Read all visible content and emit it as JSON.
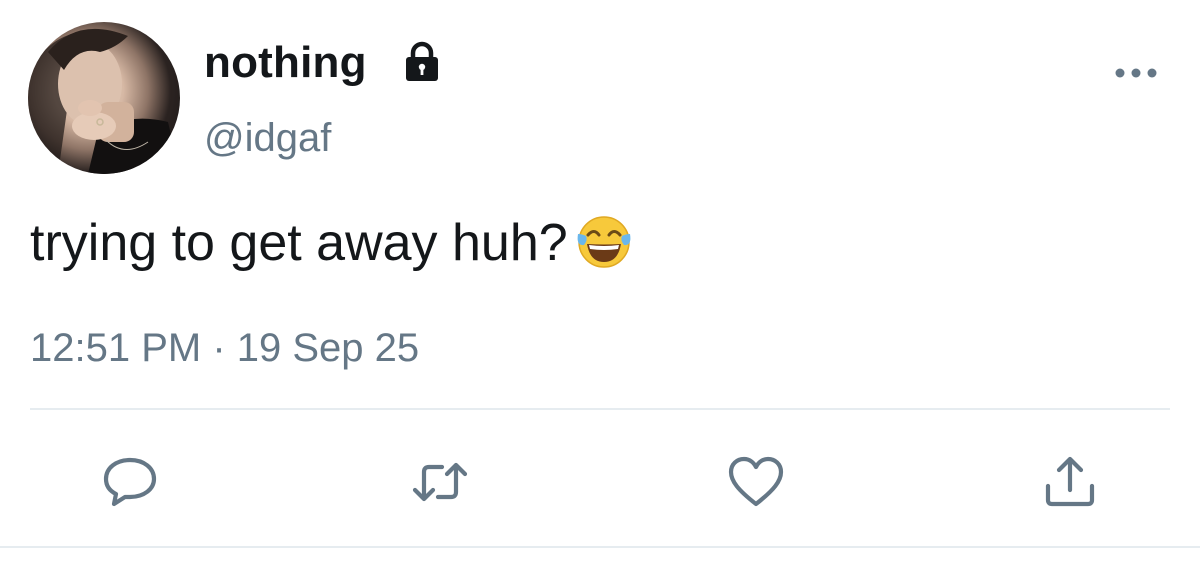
{
  "author": {
    "display_name": "nothing",
    "handle": "@idgaf",
    "protected_icon": "lock-icon",
    "avatar": "profile-photo"
  },
  "tweet": {
    "text": "trying to get away huh?",
    "emoji": "face-with-tears-of-joy",
    "timestamp": "12:51 PM · 19 Sep 25"
  },
  "actions": [
    {
      "name": "reply",
      "icon": "reply-icon"
    },
    {
      "name": "retweet",
      "icon": "retweet-icon"
    },
    {
      "name": "like",
      "icon": "heart-icon"
    },
    {
      "name": "share",
      "icon": "share-icon"
    }
  ],
  "menu": {
    "icon": "more-horizontal-icon"
  },
  "colors": {
    "text_primary": "#14171a",
    "text_secondary": "#657786",
    "icon_gray": "#657786",
    "divider": "#e6ecf0",
    "background": "#ffffff"
  }
}
